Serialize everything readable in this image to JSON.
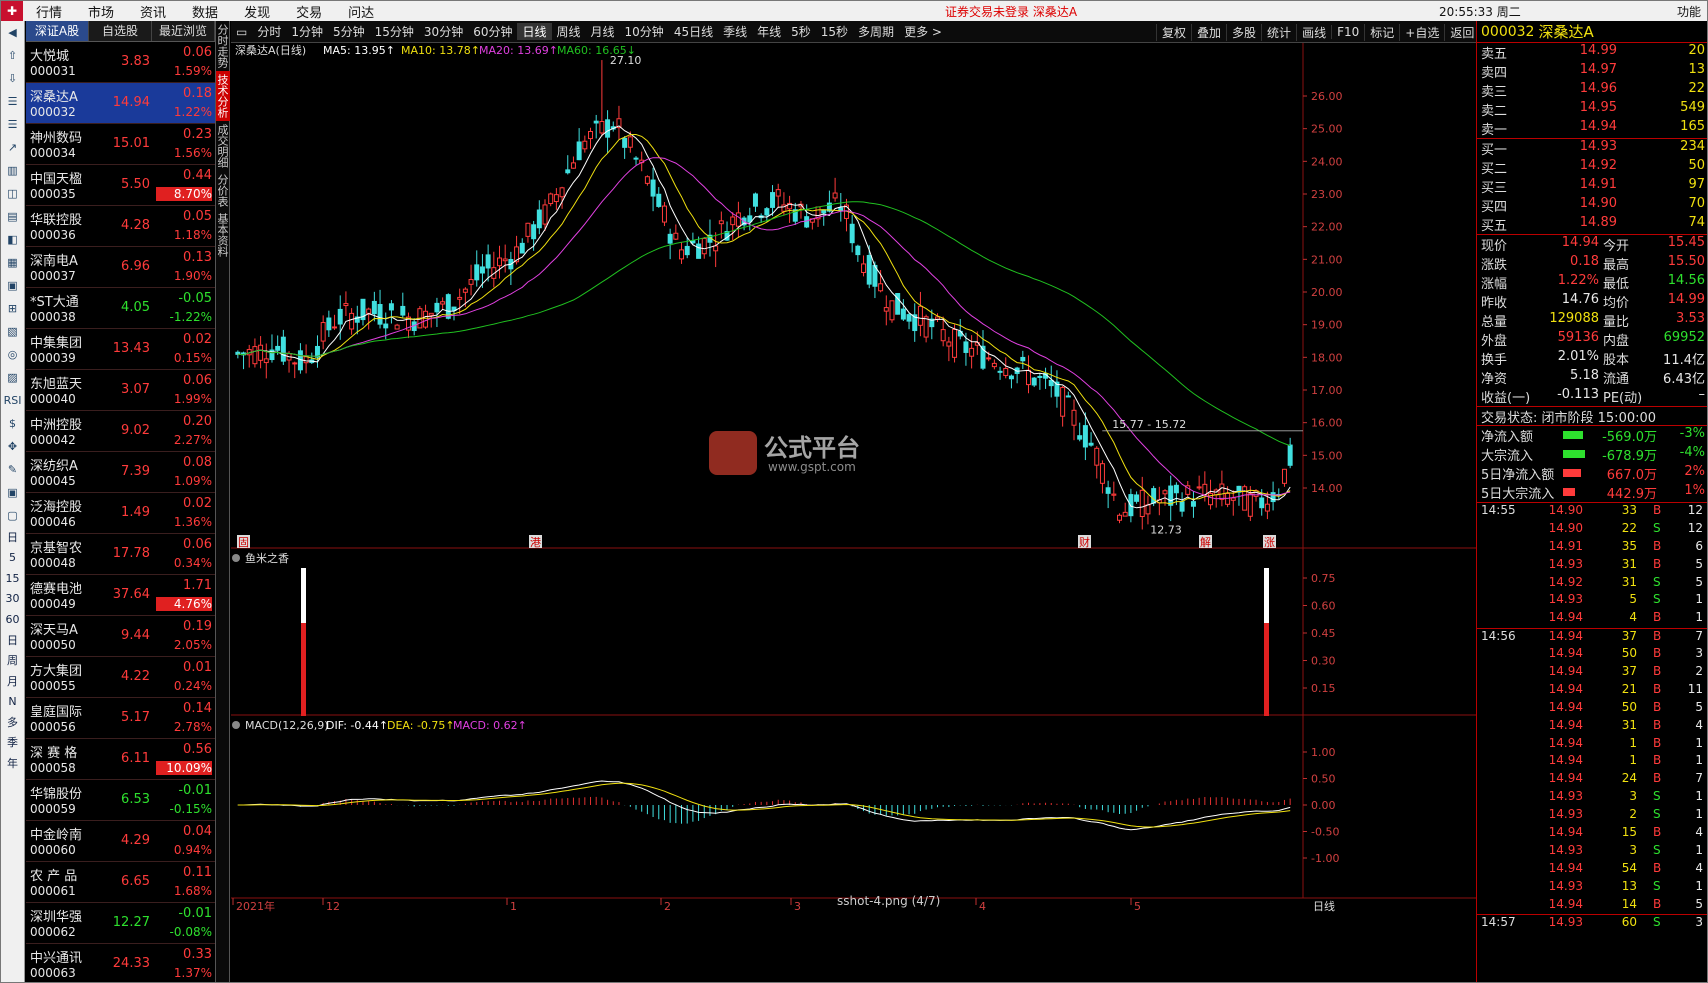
{
  "menubar": {
    "items": [
      "行情",
      "市场",
      "资讯",
      "数据",
      "发现",
      "交易",
      "问达"
    ],
    "login": "证券交易未登录  深桑达A",
    "clock": "20:55:33 周二",
    "func": "功能"
  },
  "iconbar": [
    "日",
    "5",
    "15",
    "30",
    "60",
    "日",
    "周",
    "月",
    "N",
    "多",
    "季",
    "年"
  ],
  "stocklist": {
    "tabs": [
      "深证A股",
      "自选股",
      "最近浏览"
    ],
    "rows": [
      {
        "name": "大悦城",
        "code": "000031",
        "price": "3.83",
        "chg": "0.06",
        "pct": "1.59%",
        "dir": "up"
      },
      {
        "name": "深桑达A",
        "code": "000032",
        "price": "14.94",
        "chg": "0.18",
        "pct": "1.22%",
        "dir": "up",
        "sel": true
      },
      {
        "name": "神州数码",
        "code": "000034",
        "price": "15.01",
        "chg": "0.23",
        "pct": "1.56%",
        "dir": "up"
      },
      {
        "name": "中国天楹",
        "code": "000035",
        "price": "5.50",
        "chg": "0.44",
        "pct": "8.70%",
        "dir": "up",
        "hl": true
      },
      {
        "name": "华联控股",
        "code": "000036",
        "price": "4.28",
        "chg": "0.05",
        "pct": "1.18%",
        "dir": "up"
      },
      {
        "name": "深南电A",
        "code": "000037",
        "price": "6.96",
        "chg": "0.13",
        "pct": "1.90%",
        "dir": "up"
      },
      {
        "name": "*ST大通",
        "code": "000038",
        "price": "4.05",
        "chg": "-0.05",
        "pct": "-1.22%",
        "dir": "dn"
      },
      {
        "name": "中集集团",
        "code": "000039",
        "price": "13.43",
        "chg": "0.02",
        "pct": "0.15%",
        "dir": "up"
      },
      {
        "name": "东旭蓝天",
        "code": "000040",
        "price": "3.07",
        "chg": "0.06",
        "pct": "1.99%",
        "dir": "up"
      },
      {
        "name": "中洲控股",
        "code": "000042",
        "price": "9.02",
        "chg": "0.20",
        "pct": "2.27%",
        "dir": "up"
      },
      {
        "name": "深纺织A",
        "code": "000045",
        "price": "7.39",
        "chg": "0.08",
        "pct": "1.09%",
        "dir": "up"
      },
      {
        "name": "泛海控股",
        "code": "000046",
        "price": "1.49",
        "chg": "0.02",
        "pct": "1.36%",
        "dir": "up"
      },
      {
        "name": "京基智农",
        "code": "000048",
        "price": "17.78",
        "chg": "0.06",
        "pct": "0.34%",
        "dir": "up"
      },
      {
        "name": "德赛电池",
        "code": "000049",
        "price": "37.64",
        "chg": "1.71",
        "pct": "4.76%",
        "dir": "up",
        "hl": true
      },
      {
        "name": "深天马A",
        "code": "000050",
        "price": "9.44",
        "chg": "0.19",
        "pct": "2.05%",
        "dir": "up"
      },
      {
        "name": "方大集团",
        "code": "000055",
        "price": "4.22",
        "chg": "0.01",
        "pct": "0.24%",
        "dir": "up"
      },
      {
        "name": "皇庭国际",
        "code": "000056",
        "price": "5.17",
        "chg": "0.14",
        "pct": "2.78%",
        "dir": "up"
      },
      {
        "name": "深 赛 格",
        "code": "000058",
        "price": "6.11",
        "chg": "0.56",
        "pct": "10.09%",
        "dir": "up",
        "hl": true
      },
      {
        "name": "华锦股份",
        "code": "000059",
        "price": "6.53",
        "chg": "-0.01",
        "pct": "-0.15%",
        "dir": "dn"
      },
      {
        "name": "中金岭南",
        "code": "000060",
        "price": "4.29",
        "chg": "0.04",
        "pct": "0.94%",
        "dir": "up"
      },
      {
        "name": "农 产 品",
        "code": "000061",
        "price": "6.65",
        "chg": "0.11",
        "pct": "1.68%",
        "dir": "up"
      },
      {
        "name": "深圳华强",
        "code": "000062",
        "price": "12.27",
        "chg": "-0.01",
        "pct": "-0.08%",
        "dir": "dn"
      },
      {
        "name": "中兴通讯",
        "code": "000063",
        "price": "24.33",
        "chg": "0.33",
        "pct": "1.37%",
        "dir": "up"
      }
    ]
  },
  "vtabs": [
    "分时走势",
    "技术分析",
    "成交明细",
    "分价表",
    "基本资料"
  ],
  "toolbar": {
    "periods": [
      "分时",
      "1分钟",
      "5分钟",
      "15分钟",
      "30分钟",
      "60分钟",
      "日线",
      "周线",
      "月线",
      "10分钟",
      "45日线",
      "季线",
      "年线",
      "5秒",
      "15秒",
      "多周期",
      "更多 >"
    ],
    "active": "日线",
    "right": [
      "复权",
      "叠加",
      "多股",
      "统计",
      "画线",
      "F10",
      "标记",
      "+自选",
      "返回"
    ]
  },
  "ma_legend": {
    "name": "深桑达A(日线)",
    "ma5": "MA5: 13.95↑",
    "ma10": "MA10: 13.78↑",
    "ma20": "MA20: 13.69↑",
    "ma60": "MA60: 16.65↓"
  },
  "price_axis": [
    "26.00",
    "25.00",
    "24.00",
    "23.00",
    "22.00",
    "21.00",
    "20.00",
    "19.00",
    "18.00",
    "17.00",
    "16.00",
    "15.00",
    "14.00"
  ],
  "annotations": {
    "high": "27.10",
    "low": "12.73",
    "range": "15.77 - 15.72",
    "markers": [
      "固",
      "港",
      "财",
      "解",
      "涨"
    ]
  },
  "indicator1": {
    "name": "鱼米之香",
    "axis": [
      "0.75",
      "0.60",
      "0.45",
      "0.30",
      "0.15"
    ]
  },
  "macd": {
    "name": "MACD(12,26,9)",
    "dif": "DIF: -0.44↑",
    "dea": "DEA: -0.75↑",
    "macd": "MACD: 0.62↑",
    "axis": [
      "1.00",
      "0.50",
      "0.00",
      "-0.50",
      "-1.00"
    ]
  },
  "date_axis": [
    "2021年",
    "12",
    "1",
    "2",
    "3",
    "4",
    "5"
  ],
  "date_axis_right": "日线",
  "footer": {
    "file": "sshot-4.png (4/7)",
    "site": "www.gspt.com"
  },
  "watermark": {
    "brand": "公式平台",
    "site": "www.gspt.com"
  },
  "colors": {
    "up": "#ff3b3b",
    "down": "#2ee02e",
    "ma5": "#ffffff",
    "ma10": "#f0e010",
    "ma20": "#e040e0",
    "ma60": "#20c020",
    "candle_up": "#ff3b3b",
    "candle_dn": "#40e0e0"
  },
  "right": {
    "code": "000032",
    "name": "深桑达A",
    "asks": [
      {
        "l": "卖五",
        "p": "14.99",
        "v": "20"
      },
      {
        "l": "卖四",
        "p": "14.97",
        "v": "13"
      },
      {
        "l": "卖三",
        "p": "14.96",
        "v": "22"
      },
      {
        "l": "卖二",
        "p": "14.95",
        "v": "549"
      },
      {
        "l": "卖一",
        "p": "14.94",
        "v": "165"
      }
    ],
    "bids": [
      {
        "l": "买一",
        "p": "14.93",
        "v": "234"
      },
      {
        "l": "买二",
        "p": "14.92",
        "v": "50"
      },
      {
        "l": "买三",
        "p": "14.91",
        "v": "97"
      },
      {
        "l": "买四",
        "p": "14.90",
        "v": "70"
      },
      {
        "l": "买五",
        "p": "14.89",
        "v": "74"
      }
    ],
    "quote": [
      {
        "a": "现价",
        "av": "14.94",
        "b": "今开",
        "bv": "15.45",
        "ac": "up",
        "bc": "up"
      },
      {
        "a": "涨跌",
        "av": "0.18",
        "b": "最高",
        "bv": "15.50",
        "ac": "up",
        "bc": "up"
      },
      {
        "a": "涨幅",
        "av": "1.22%",
        "b": "最低",
        "bv": "14.56",
        "ac": "up",
        "bc": "dn"
      },
      {
        "a": "昨收",
        "av": "14.76",
        "b": "均价",
        "bv": "14.99",
        "ac": "wh",
        "bc": "up"
      },
      {
        "a": "总量",
        "av": "129088",
        "b": "量比",
        "bv": "3.53",
        "ac": "yl",
        "bc": "up"
      },
      {
        "a": "外盘",
        "av": "59136",
        "b": "内盘",
        "bv": "69952",
        "ac": "up",
        "bc": "dn"
      },
      {
        "a": "换手",
        "av": "2.01%",
        "b": "股本",
        "bv": "11.4亿",
        "ac": "wh",
        "bc": "wh"
      },
      {
        "a": "净资",
        "av": "5.18",
        "b": "流通",
        "bv": "6.43亿",
        "ac": "wh",
        "bc": "wh"
      },
      {
        "a": "收益(一)",
        "av": "-0.113",
        "b": "PE(动)",
        "bv": "–",
        "ac": "wh",
        "bc": "wh"
      }
    ],
    "status": "交易状态: 闭市阶段 15:00:00",
    "flows": [
      {
        "l": "净流入额",
        "v": "-569.0万",
        "p": "-3%",
        "c": "dn",
        "w": 20
      },
      {
        "l": "大宗流入",
        "v": "-678.9万",
        "p": "-4%",
        "c": "dn",
        "w": 22
      },
      {
        "l": "5日净流入额",
        "v": "667.0万",
        "p": "2%",
        "c": "up",
        "w": 18
      },
      {
        "l": "5日大宗流入",
        "v": "442.9万",
        "p": "1%",
        "c": "up",
        "w": 12
      }
    ],
    "ticks": [
      {
        "t": "14:55",
        "p": "14.90",
        "v": "33",
        "bs": "B",
        "n": "12"
      },
      {
        "t": "",
        "p": "14.90",
        "v": "22",
        "bs": "S",
        "n": "12"
      },
      {
        "t": "",
        "p": "14.91",
        "v": "35",
        "bs": "B",
        "n": "6"
      },
      {
        "t": "",
        "p": "14.93",
        "v": "31",
        "bs": "B",
        "n": "5"
      },
      {
        "t": "",
        "p": "14.92",
        "v": "31",
        "bs": "S",
        "n": "5"
      },
      {
        "t": "",
        "p": "14.93",
        "v": "5",
        "bs": "S",
        "n": "1"
      },
      {
        "t": "",
        "p": "14.94",
        "v": "4",
        "bs": "B",
        "n": "1"
      },
      {
        "t": "14:56",
        "p": "14.94",
        "v": "37",
        "bs": "B",
        "n": "7"
      },
      {
        "t": "",
        "p": "14.94",
        "v": "50",
        "bs": "B",
        "n": "3"
      },
      {
        "t": "",
        "p": "14.94",
        "v": "37",
        "bs": "B",
        "n": "2"
      },
      {
        "t": "",
        "p": "14.94",
        "v": "21",
        "bs": "B",
        "n": "11"
      },
      {
        "t": "",
        "p": "14.94",
        "v": "50",
        "bs": "B",
        "n": "5"
      },
      {
        "t": "",
        "p": "14.94",
        "v": "31",
        "bs": "B",
        "n": "4"
      },
      {
        "t": "",
        "p": "14.94",
        "v": "1",
        "bs": "B",
        "n": "1"
      },
      {
        "t": "",
        "p": "14.94",
        "v": "1",
        "bs": "B",
        "n": "1"
      },
      {
        "t": "",
        "p": "14.94",
        "v": "24",
        "bs": "B",
        "n": "7"
      },
      {
        "t": "",
        "p": "14.93",
        "v": "3",
        "bs": "S",
        "n": "1"
      },
      {
        "t": "",
        "p": "14.93",
        "v": "2",
        "bs": "S",
        "n": "1"
      },
      {
        "t": "",
        "p": "14.94",
        "v": "15",
        "bs": "B",
        "n": "4"
      },
      {
        "t": "",
        "p": "14.93",
        "v": "3",
        "bs": "S",
        "n": "1"
      },
      {
        "t": "",
        "p": "14.94",
        "v": "54",
        "bs": "B",
        "n": "4"
      },
      {
        "t": "",
        "p": "14.93",
        "v": "13",
        "bs": "S",
        "n": "1"
      },
      {
        "t": "",
        "p": "14.94",
        "v": "14",
        "bs": "B",
        "n": "5"
      },
      {
        "t": "14:57",
        "p": "14.93",
        "v": "60",
        "bs": "S",
        "n": "3"
      }
    ]
  }
}
